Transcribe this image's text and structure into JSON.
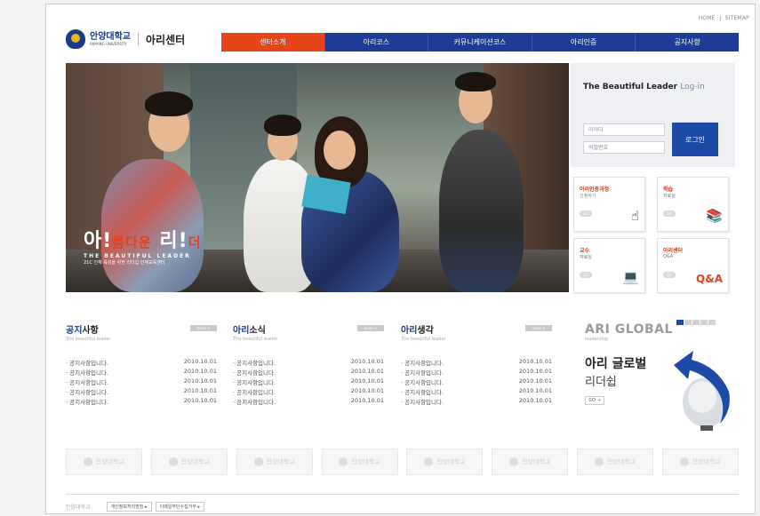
{
  "util_nav": {
    "home": "HOME",
    "sitemap": "SITEMAP"
  },
  "logo": {
    "univ_ko": "안양대학교",
    "univ_en": "ANYANG UNIVERSITY",
    "center": "아리센터"
  },
  "nav": [
    "센터소개",
    "아리코스",
    "커뮤니케이션코스",
    "아리인증",
    "공지사항"
  ],
  "hero": {
    "slogan_a": "아",
    "slogan_b": "름다운",
    "slogan_c": "리",
    "slogan_d": "더",
    "english": "THE BEAUTIFUL LEADER",
    "sub": "21C 인재 육성을 위한 리더십 인재교육센터"
  },
  "login": {
    "title": "The Beautiful Leader",
    "title2": "Log-in",
    "id_placeholder": "아이디",
    "pw_placeholder": "비밀번호",
    "button": "로그인"
  },
  "quick": [
    {
      "title": "아리인증과정",
      "sub": "신청하기",
      "go": "GO"
    },
    {
      "title": "학습",
      "sub": "자료실",
      "go": "GO"
    },
    {
      "title": "교수",
      "sub": "자료실",
      "go": "GO"
    },
    {
      "title": "아리센터",
      "sub": "Q&A",
      "go": "GO"
    }
  ],
  "boards": [
    {
      "title_a": "공지",
      "title_b": "사항",
      "sub": "The beautiful leader",
      "more": "more +",
      "items": [
        {
          "t": "· 공지사항입니다.",
          "d": "2010.10.01"
        },
        {
          "t": "· 공지사항입니다.",
          "d": "2010.10.01"
        },
        {
          "t": "· 공지사항입니다.",
          "d": "2010.10.01"
        },
        {
          "t": "· 공지사항입니다.",
          "d": "2010.10.01"
        },
        {
          "t": "· 공지사항입니다.",
          "d": "2010.10.01"
        }
      ]
    },
    {
      "title_a": "아리",
      "title_b": "소식",
      "sub": "The beautiful leader",
      "more": "more +",
      "items": [
        {
          "t": "· 공지사항입니다.",
          "d": "2010.10.01"
        },
        {
          "t": "· 공지사항입니다.",
          "d": "2010.10.01"
        },
        {
          "t": "· 공지사항입니다.",
          "d": "2010.10.01"
        },
        {
          "t": "· 공지사항입니다.",
          "d": "2010.10.01"
        },
        {
          "t": "· 공지사항입니다.",
          "d": "2010.10.01"
        }
      ]
    },
    {
      "title_a": "아리",
      "title_b": "생각",
      "sub": "The beautiful leader",
      "more": "more +",
      "items": [
        {
          "t": "· 공지사항입니다.",
          "d": "2010.10.01"
        },
        {
          "t": "· 공지사항입니다.",
          "d": "2010.10.01"
        },
        {
          "t": "· 공지사항입니다.",
          "d": "2010.10.01"
        },
        {
          "t": "· 공지사항입니다.",
          "d": "2010.10.01"
        },
        {
          "t": "· 공지사항입니다.",
          "d": "2010.10.01"
        }
      ]
    }
  ],
  "global": {
    "title": "ARI GLOBAL",
    "sub": "leadership",
    "ko1": "아리 글로벌",
    "ko2": "리더쉽",
    "go": "GO →"
  },
  "banners": [
    "안양대학교",
    "안양대학교",
    "안양대학교",
    "안양대학교",
    "안양대학교",
    "안양대학교",
    "안양대학교",
    "안양대학교"
  ],
  "footer": {
    "logo": "안양대학교",
    "link1": "개인정보처리방침 ▸",
    "link2": "이메일무단수집거부 ▸"
  }
}
